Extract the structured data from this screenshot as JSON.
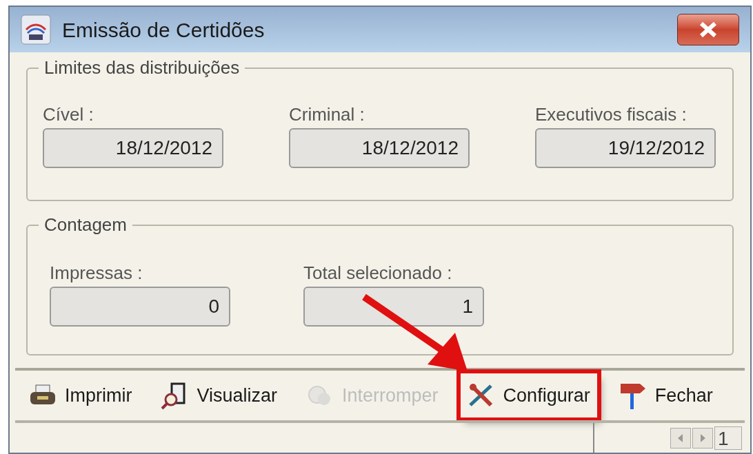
{
  "window": {
    "title": "Emissão de Certidões"
  },
  "groups": [
    {
      "title": "Limites das distribuições",
      "fields": [
        {
          "label": "Cível :",
          "value": "18/12/2012"
        },
        {
          "label": "Criminal :",
          "value": "18/12/2012"
        },
        {
          "label": "Executivos fiscais :",
          "value": "19/12/2012"
        }
      ]
    },
    {
      "title": "Contagem",
      "fields": [
        {
          "label": "Impressas :",
          "value": "0"
        },
        {
          "label": "Total selecionado :",
          "value": "1"
        }
      ]
    }
  ],
  "toolbar": [
    {
      "kind": "print",
      "label": "Imprimir",
      "disabled": false,
      "highlighted": false
    },
    {
      "kind": "preview",
      "label": "Visualizar",
      "disabled": false,
      "highlighted": false
    },
    {
      "kind": "stop",
      "label": "Interromper",
      "disabled": true,
      "highlighted": false
    },
    {
      "kind": "configure",
      "label": "Configurar",
      "disabled": false,
      "highlighted": true
    },
    {
      "kind": "close",
      "label": "Fechar",
      "disabled": false,
      "highlighted": false
    }
  ],
  "status_bar": {
    "page": "1"
  }
}
